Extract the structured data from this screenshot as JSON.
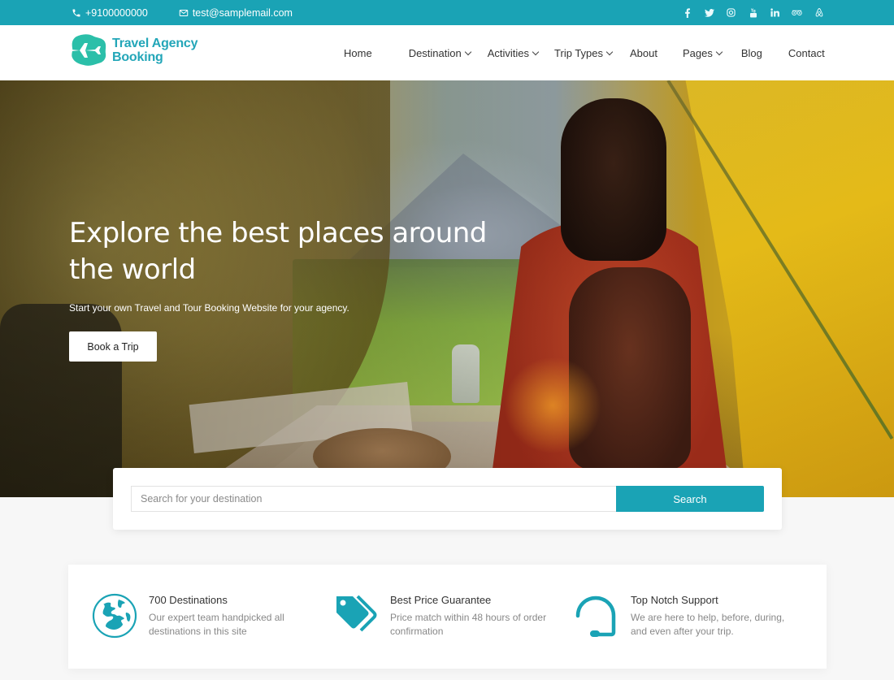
{
  "topbar": {
    "phone": "+9100000000",
    "email": "test@samplemail.com",
    "social": [
      {
        "name": "facebook-icon",
        "glyph": "f"
      },
      {
        "name": "twitter-icon",
        "glyph": "t"
      },
      {
        "name": "instagram-icon",
        "glyph": "ig"
      },
      {
        "name": "youtube-icon",
        "glyph": "yt"
      },
      {
        "name": "linkedin-icon",
        "glyph": "in"
      },
      {
        "name": "tripadvisor-icon",
        "glyph": "oo"
      },
      {
        "name": "airbnb-icon",
        "glyph": "a"
      }
    ]
  },
  "brand": {
    "line1": "Travel Agency",
    "line2": "Booking",
    "color": "#23a6b8"
  },
  "nav": {
    "items": [
      {
        "label": "Home",
        "dropdown": false
      },
      {
        "label": "Destination",
        "dropdown": true
      },
      {
        "label": "Activities",
        "dropdown": true
      },
      {
        "label": "Trip Types",
        "dropdown": true
      },
      {
        "label": "About",
        "dropdown": false
      },
      {
        "label": "Pages",
        "dropdown": true
      },
      {
        "label": "Blog",
        "dropdown": false
      },
      {
        "label": "Contact",
        "dropdown": false
      }
    ]
  },
  "hero": {
    "title_line1": "Explore the best places around",
    "title_line2": "the world",
    "subtitle": "Start your own Travel and Tour Booking Website for your agency.",
    "cta_label": "Book a Trip"
  },
  "search": {
    "placeholder": "Search for your destination",
    "value": "",
    "button_label": "Search"
  },
  "features": [
    {
      "icon": "globe-icon",
      "title": "700 Destinations",
      "desc": "Our expert team handpicked all destinations in this site"
    },
    {
      "icon": "price-tag-icon",
      "title": "Best Price Guarantee",
      "desc": "Price match within 48 hours of order confirmation"
    },
    {
      "icon": "headset-icon",
      "title": "Top Notch Support",
      "desc": "We are here to help, before, during, and even after your trip."
    }
  ],
  "colors": {
    "accent": "#1aa3b5",
    "text": "#333333",
    "muted": "#888888"
  }
}
